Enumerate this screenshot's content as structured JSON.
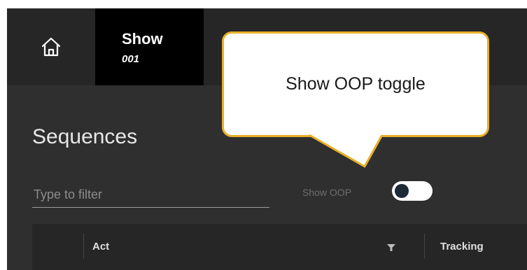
{
  "topbar": {
    "home_icon": "home-icon",
    "show_tab": {
      "title": "Show",
      "code": "001"
    }
  },
  "page": {
    "title": "Sequences"
  },
  "filter": {
    "value": "",
    "placeholder": "Type to filter"
  },
  "oop_toggle": {
    "label": "Show OOP",
    "enabled": false
  },
  "table": {
    "columns": [
      {
        "label": "Act",
        "filter_icon": "filter-icon"
      },
      {
        "label": "Tracking"
      }
    ]
  },
  "callout": {
    "text": "Show OOP toggle",
    "border_color": "#e8b028"
  },
  "colors": {
    "background": "#2f2f2f",
    "topbar": "#262626",
    "active_tab": "#000000",
    "toggle_track": "#ffffff",
    "toggle_knob": "#1e2a36"
  }
}
